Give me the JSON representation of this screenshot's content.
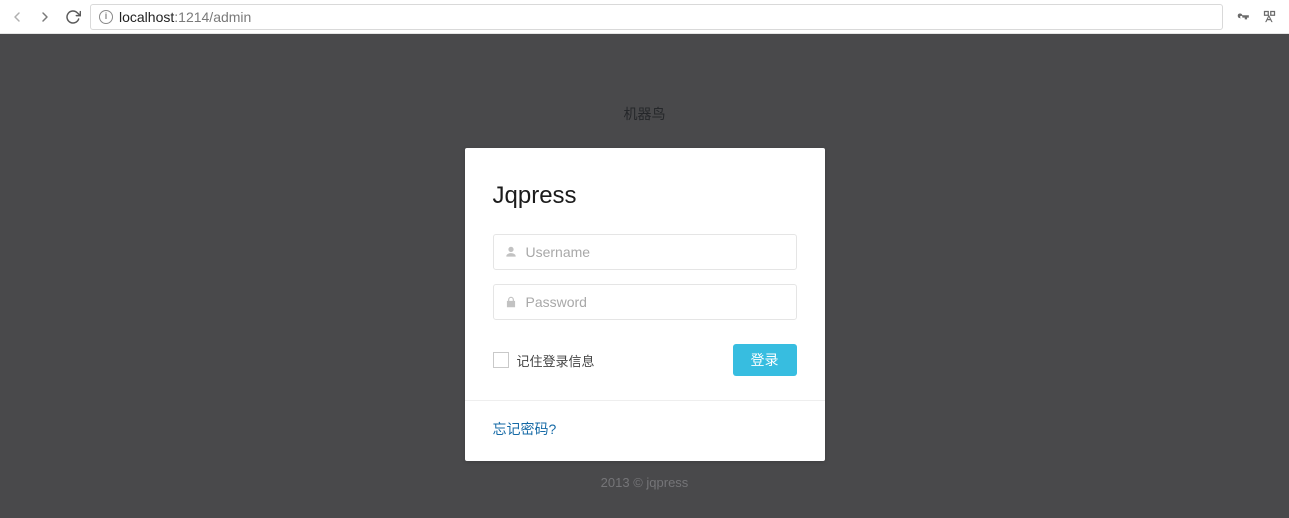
{
  "browser": {
    "url_host": "localhost",
    "url_portpath": ":1214/admin"
  },
  "header": {
    "site_title": "机器鸟"
  },
  "login": {
    "brand": "Jqpress",
    "username_placeholder": "Username",
    "password_placeholder": "Password",
    "remember_label": "记住登录信息",
    "login_button": "登录",
    "forgot_link": "忘记密码?"
  },
  "footer": {
    "copyright": "2013 © jqpress"
  }
}
